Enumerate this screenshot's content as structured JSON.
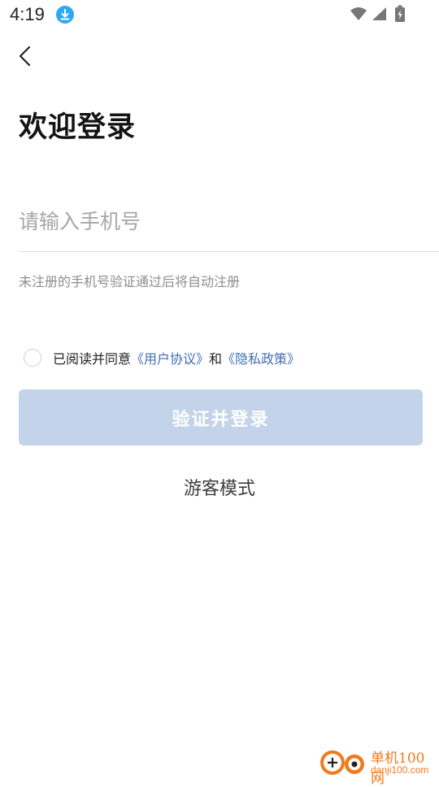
{
  "status_bar": {
    "time": "4:19",
    "icons": [
      "download-icon",
      "wifi-icon",
      "signal-icon",
      "battery-charging-icon"
    ]
  },
  "header": {
    "back_icon": "chevron-left-icon",
    "title": "欢迎登录"
  },
  "form": {
    "phone_placeholder": "请输入手机号",
    "phone_value": "",
    "hint": "未注册的手机号验证通过后将自动注册",
    "agreement": {
      "checked": false,
      "prefix": "已阅读并同意",
      "user_agreement": "《用户协议》",
      "and": "和",
      "privacy_policy": "《隐私政策》"
    },
    "submit_label": "验证并登录",
    "guest_label": "游客模式"
  },
  "watermark": {
    "text_cn": "单机100网",
    "text_url": "danji100.com"
  },
  "colors": {
    "link": "#3f6fb6",
    "button_disabled": "#c2d3ea",
    "watermark": "#f07a1c",
    "download_badge": "#2fa8f0"
  }
}
